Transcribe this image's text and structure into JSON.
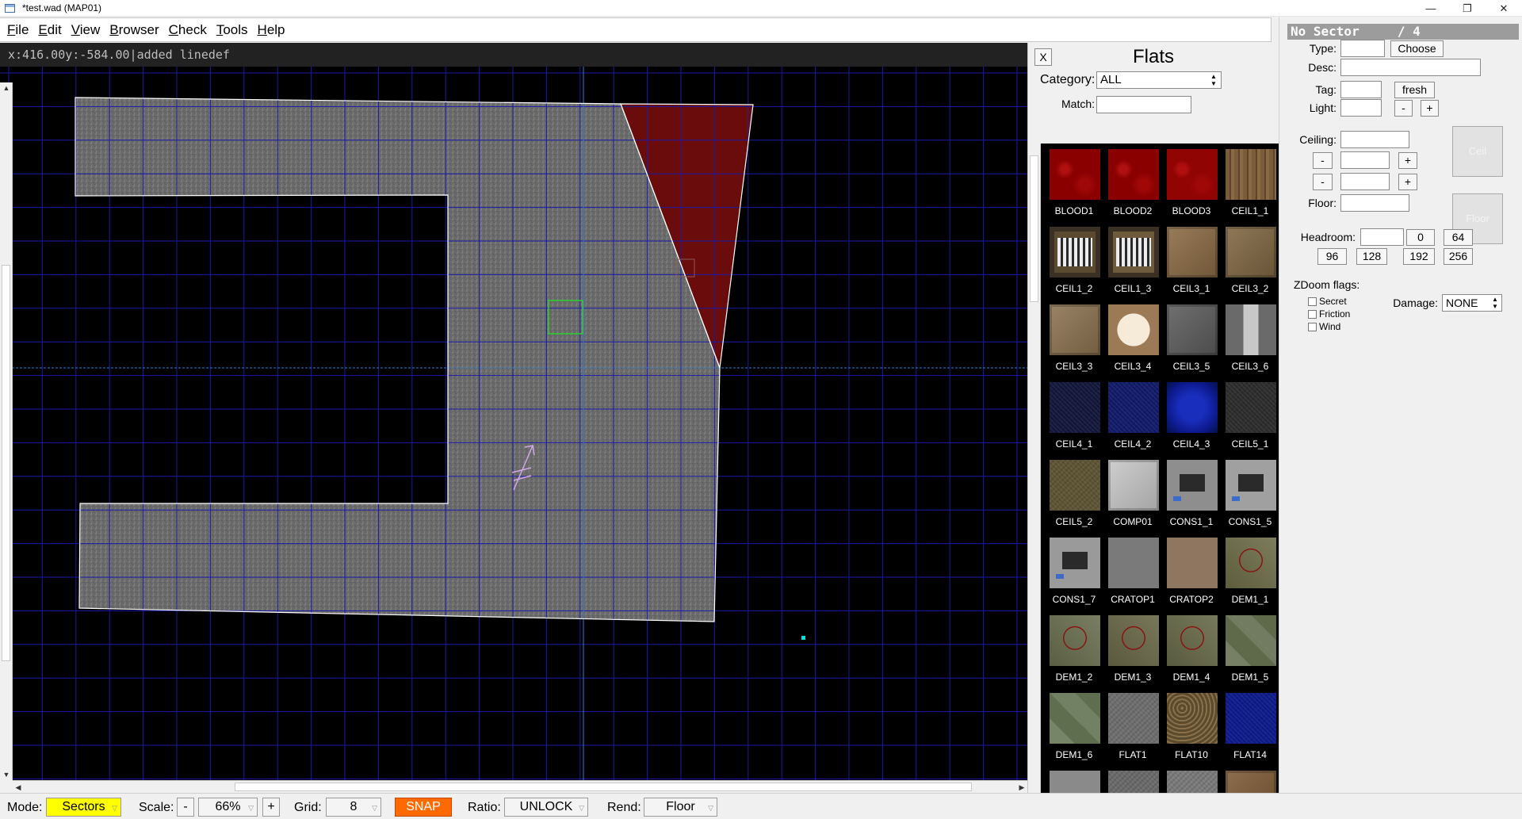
{
  "window": {
    "title": "*test.wad (MAP01)",
    "controls": [
      "—",
      "❐",
      "✕"
    ]
  },
  "menu": [
    {
      "label": "File",
      "u": "F",
      "rest": "ile"
    },
    {
      "label": "Edit",
      "u": "E",
      "rest": "dit"
    },
    {
      "label": "View",
      "u": "V",
      "rest": "iew"
    },
    {
      "label": "Browser",
      "u": "B",
      "rest": "rowser"
    },
    {
      "label": "Check",
      "u": "C",
      "rest": "heck"
    },
    {
      "label": "Tools",
      "u": "T",
      "rest": "ools"
    },
    {
      "label": "Help",
      "u": "H",
      "rest": "elp"
    }
  ],
  "status_info": {
    "x": "x:416.00",
    "y": "y:-584.00",
    "sep": "|",
    "message": "added linedef"
  },
  "flats_panel": {
    "close_label": "X",
    "title": "Flats",
    "category_label": "Category:",
    "category_value": "ALL",
    "match_label": "Match:",
    "match_value": "",
    "tiles": [
      {
        "name": "BLOOD1",
        "color": "#8a0000",
        "pattern": "blood"
      },
      {
        "name": "BLOOD2",
        "color": "#8a0000",
        "pattern": "blood"
      },
      {
        "name": "BLOOD3",
        "color": "#900404",
        "pattern": "blood"
      },
      {
        "name": "CEIL1_1",
        "color": "#7a5c3a",
        "pattern": "wood"
      },
      {
        "name": "CEIL1_2",
        "color": "#5a4a30",
        "pattern": "grate"
      },
      {
        "name": "CEIL1_3",
        "color": "#6e5a3c",
        "pattern": "grate"
      },
      {
        "name": "CEIL3_1",
        "color": "#8a6a44",
        "pattern": "panel"
      },
      {
        "name": "CEIL3_2",
        "color": "#7f6642",
        "pattern": "panel"
      },
      {
        "name": "CEIL3_3",
        "color": "#8c7250",
        "pattern": "panel"
      },
      {
        "name": "CEIL3_4",
        "color": "#9c7a56",
        "pattern": "light"
      },
      {
        "name": "CEIL3_5",
        "color": "#5c5c5c",
        "pattern": "panel"
      },
      {
        "name": "CEIL3_6",
        "color": "#6a6a6a",
        "pattern": "lightgray"
      },
      {
        "name": "CEIL4_1",
        "color": "#12163a",
        "pattern": "noise"
      },
      {
        "name": "CEIL4_2",
        "color": "#101a6a",
        "pattern": "noise"
      },
      {
        "name": "CEIL4_3",
        "color": "#0c1a8c",
        "pattern": "glow"
      },
      {
        "name": "CEIL5_1",
        "color": "#2c2c2c",
        "pattern": "noise"
      },
      {
        "name": "CEIL5_2",
        "color": "#5e5434",
        "pattern": "noise"
      },
      {
        "name": "COMP01",
        "color": "#c8c8c8",
        "pattern": "panel"
      },
      {
        "name": "CONS1_1",
        "color": "#8e8e8e",
        "pattern": "console"
      },
      {
        "name": "CONS1_5",
        "color": "#a0a0a0",
        "pattern": "console"
      },
      {
        "name": "CONS1_7",
        "color": "#9a9a9a",
        "pattern": "console"
      },
      {
        "name": "CRATOP1",
        "color": "#7a7a7a",
        "pattern": "flat"
      },
      {
        "name": "CRATOP2",
        "color": "#8e7660",
        "pattern": "flat"
      },
      {
        "name": "DEM1_1",
        "color": "#6e6e4a",
        "pattern": "demon"
      },
      {
        "name": "DEM1_2",
        "color": "#6a7050",
        "pattern": "demon"
      },
      {
        "name": "DEM1_3",
        "color": "#6a6848",
        "pattern": "demon"
      },
      {
        "name": "DEM1_4",
        "color": "#686a4a",
        "pattern": "demon"
      },
      {
        "name": "DEM1_5",
        "color": "#5e6a4a",
        "pattern": "marble"
      },
      {
        "name": "DEM1_6",
        "color": "#5e6e4e",
        "pattern": "marble"
      },
      {
        "name": "FLAT1",
        "color": "#6e6e6e",
        "pattern": "noise"
      },
      {
        "name": "FLAT10",
        "color": "#5a4a2e",
        "pattern": "gravel"
      },
      {
        "name": "FLAT14",
        "color": "#0c1a8c",
        "pattern": "noise"
      },
      {
        "name": "",
        "color": "#8a8a8a",
        "pattern": "flat"
      },
      {
        "name": "",
        "color": "#6a6a6a",
        "pattern": "noise"
      },
      {
        "name": "",
        "color": "#7a7a7a",
        "pattern": "noise"
      },
      {
        "name": "",
        "color": "#7e5a36",
        "pattern": "panel"
      }
    ]
  },
  "sector_panel": {
    "header_name": "No Sector",
    "header_count": "/ 4",
    "type_label": "Type:",
    "type_value": "",
    "choose_label": "Choose",
    "desc_label": "Desc:",
    "desc_value": "",
    "tag_label": "Tag:",
    "tag_value": "",
    "fresh_label": "fresh",
    "light_label": "Light:",
    "light_value": "",
    "minus": "-",
    "plus": "+",
    "ceiling_label": "Ceiling:",
    "ceiling_value": "",
    "floor_label": "Floor:",
    "floor_value": "",
    "ceil_tex_label": "Ceil",
    "floor_tex_label": "Floor",
    "headroom_label": "Headroom:",
    "headroom_value": "",
    "headroom_presets": [
      "0",
      "64",
      "96",
      "128",
      "192",
      "256"
    ],
    "zdoom_label": "ZDoom flags:",
    "flags": [
      "Secret",
      "Friction",
      "Wind"
    ],
    "damage_label": "Damage:",
    "damage_value": "NONE"
  },
  "statusbar": {
    "mode_label": "Mode:",
    "mode_value": "Sectors",
    "scale_label": "Scale:",
    "scale_minus": "-",
    "scale_value": "66%",
    "scale_plus": "+",
    "grid_label": "Grid:",
    "grid_value": "8",
    "snap_label": "SNAP",
    "ratio_label": "Ratio:",
    "ratio_value": "UNLOCK",
    "rend_label": "Rend:",
    "rend_value": "Floor"
  },
  "colors": {
    "mode_bg": "#ffff00",
    "snap_bg": "#ff6a00",
    "grid_line": "#1a1aa8",
    "axis_line": "#2f7fd8",
    "sector_fill": "#6b6b6b",
    "selected_sector": "#6a0c0c",
    "highlight_box": "#2ad02a",
    "thing_arrow": "#d0a8e8",
    "vertex": "#00e0e0"
  }
}
